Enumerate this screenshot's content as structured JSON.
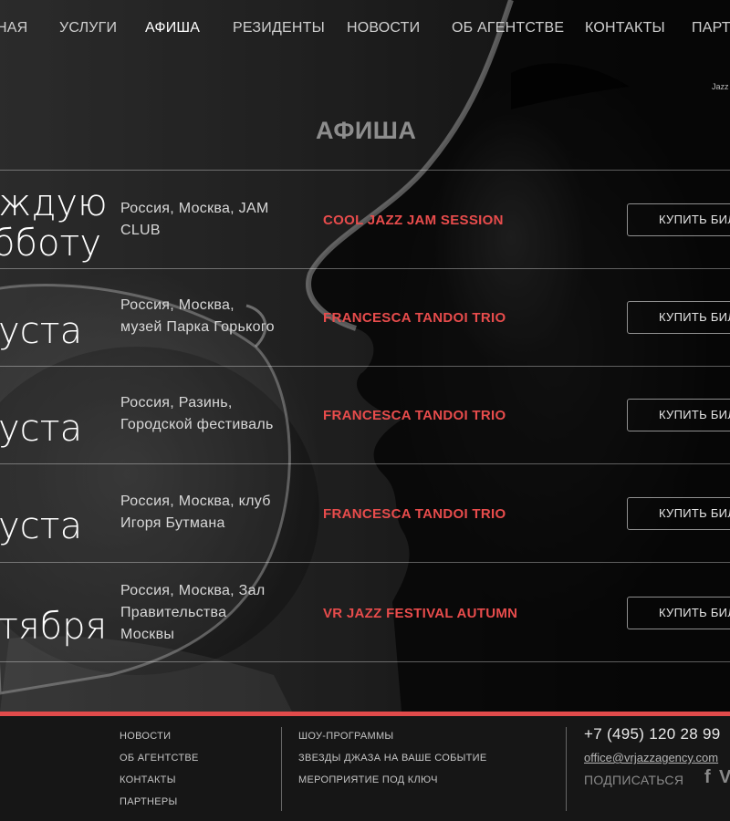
{
  "nav": {
    "items": [
      {
        "label": "НАЯ",
        "active": false
      },
      {
        "label": "УСЛУГИ",
        "active": false
      },
      {
        "label": "АФИША",
        "active": true
      },
      {
        "label": "РЕЗИДЕНТЫ",
        "active": false
      },
      {
        "label": "НОВОСТИ",
        "active": false
      },
      {
        "label": "ОБ АГЕНТСТВЕ",
        "active": false
      },
      {
        "label": "КОНТАКТЫ",
        "active": false
      },
      {
        "label": "ПАРТН",
        "active": false
      }
    ]
  },
  "header": {
    "tagline": "Jazz"
  },
  "page": {
    "title": "АФИША"
  },
  "events": [
    {
      "date_line1": "ждую",
      "date_line2": "бботу",
      "place_line1": "Россия, Москва, JAM",
      "place_line2": "CLUB",
      "place_line3": "",
      "title": "COOL JAZZ JAM SESSION",
      "buy": "КУПИТЬ БИЛ"
    },
    {
      "date_line1": "уста",
      "date_line2": "",
      "place_line1": "Россия, Москва,",
      "place_line2": "музей Парка Горького",
      "place_line3": "",
      "title": "FRANCESCA TANDOI TRIO",
      "buy": "КУПИТЬ БИЛ"
    },
    {
      "date_line1": "уста",
      "date_line2": "",
      "place_line1": "Россия, Разинь,",
      "place_line2": "Городской фестиваль",
      "place_line3": "",
      "title": "FRANCESCA TANDOI TRIO",
      "buy": "КУПИТЬ БИЛ"
    },
    {
      "date_line1": "уста",
      "date_line2": "",
      "place_line1": "Россия, Москва, клуб",
      "place_line2": "Игоря Бутмана",
      "place_line3": "",
      "title": "FRANCESCA TANDOI TRIO",
      "buy": "КУПИТЬ БИЛ"
    },
    {
      "date_line1": "тября",
      "date_line2": "",
      "place_line1": "Россия, Москва, Зал",
      "place_line2": "Правительства",
      "place_line3": "Москвы",
      "title": "VR JAZZ FESTIVAL AUTUMN",
      "buy": "КУПИТЬ БИЛ"
    }
  ],
  "footer": {
    "col1": [
      "НОВОСТИ",
      "ОБ АГЕНТСТВЕ",
      "КОНТАКТЫ",
      "ПАРТНЕРЫ"
    ],
    "col2": [
      "ШОУ-ПРОГРАММЫ",
      "ЗВЕЗДЫ ДЖАЗА НА ВАШЕ СОБЫТИЕ",
      "МЕРОПРИЯТИЕ ПОД КЛЮЧ"
    ],
    "phone": "+7 (495) 120 28 99",
    "email": "office@vrjazzagency.com",
    "subscribe": "ПОДПИСАТЬСЯ",
    "social": [
      "facebook-icon",
      "vk-icon"
    ]
  },
  "colors": {
    "accent": "#e14b4b",
    "title_red": "#e84c4c"
  }
}
